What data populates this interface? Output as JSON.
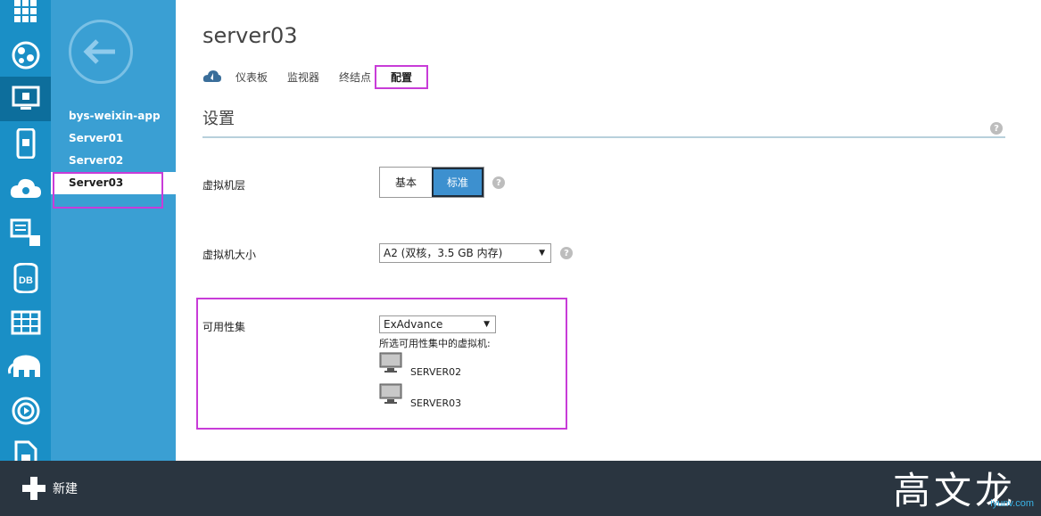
{
  "rail": {
    "icons": [
      "grid-icon",
      "web-sites-icon",
      "virtual-machine-icon",
      "mobile-services-icon",
      "cloud-services-icon",
      "batch-icon",
      "sql-database-icon",
      "storage-icon",
      "hdinsight-icon",
      "media-services-icon",
      "document-icon"
    ],
    "db_label": "DB"
  },
  "subnav": {
    "items": [
      {
        "label": "bys-weixin-app"
      },
      {
        "label": "Server01"
      },
      {
        "label": "Server02"
      },
      {
        "label": "Server03"
      }
    ]
  },
  "page": {
    "title": "server03",
    "tabs": [
      {
        "label": "仪表板"
      },
      {
        "label": "监视器"
      },
      {
        "label": "终结点"
      },
      {
        "label": "配置"
      }
    ],
    "section_title": "设置",
    "help_glyph": "?"
  },
  "settings": {
    "tier_label": "虚拟机层",
    "tier_options": [
      "基本",
      "标准"
    ],
    "tier_selected": "标准",
    "size_label": "虚拟机大小",
    "size_value": "A2 (双核，3.5 GB 内存)",
    "availability_label": "可用性集",
    "availability_value": "ExAdvance",
    "vm_list_label": "所选可用性集中的虚拟机:",
    "vms": [
      "SERVER02",
      "SERVER03"
    ]
  },
  "bottom": {
    "new_label": "新建",
    "watermark": "高文龙",
    "watermark_sub": "iyunv.com"
  }
}
